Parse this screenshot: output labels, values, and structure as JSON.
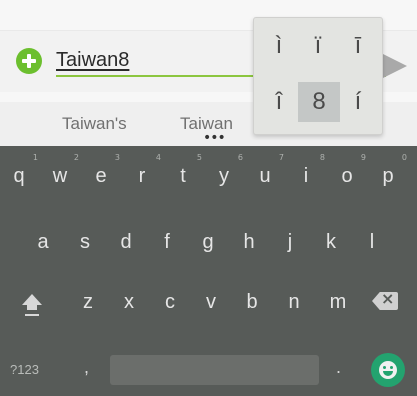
{
  "input": {
    "value": "Taiwan8"
  },
  "accent_popup": {
    "keys": [
      "ì",
      "ï",
      "ī",
      "î",
      "8",
      "í"
    ],
    "selected": "8"
  },
  "suggestions": [
    "Taiwan's",
    "Taiwan"
  ],
  "keyboard": {
    "row1": [
      "q",
      "w",
      "e",
      "r",
      "t",
      "y",
      "u",
      "i",
      "o",
      "p"
    ],
    "row1_hints": [
      "1",
      "2",
      "3",
      "4",
      "5",
      "6",
      "7",
      "8",
      "9",
      "0"
    ],
    "row2": [
      "a",
      "s",
      "d",
      "f",
      "g",
      "h",
      "j",
      "k",
      "l"
    ],
    "row3": [
      "z",
      "x",
      "c",
      "v",
      "b",
      "n",
      "m"
    ],
    "symbols_label": "?123",
    "comma_label": ",",
    "period_label": "."
  },
  "colors": {
    "accent_green": "#6cbf2e",
    "field_underline": "#8cc63f",
    "keyboard_bg": "#575b58",
    "emoji_button": "#23a36f"
  },
  "icons": [
    "add-icon",
    "send-icon",
    "shift-icon",
    "backspace-icon",
    "emoji-icon"
  ]
}
